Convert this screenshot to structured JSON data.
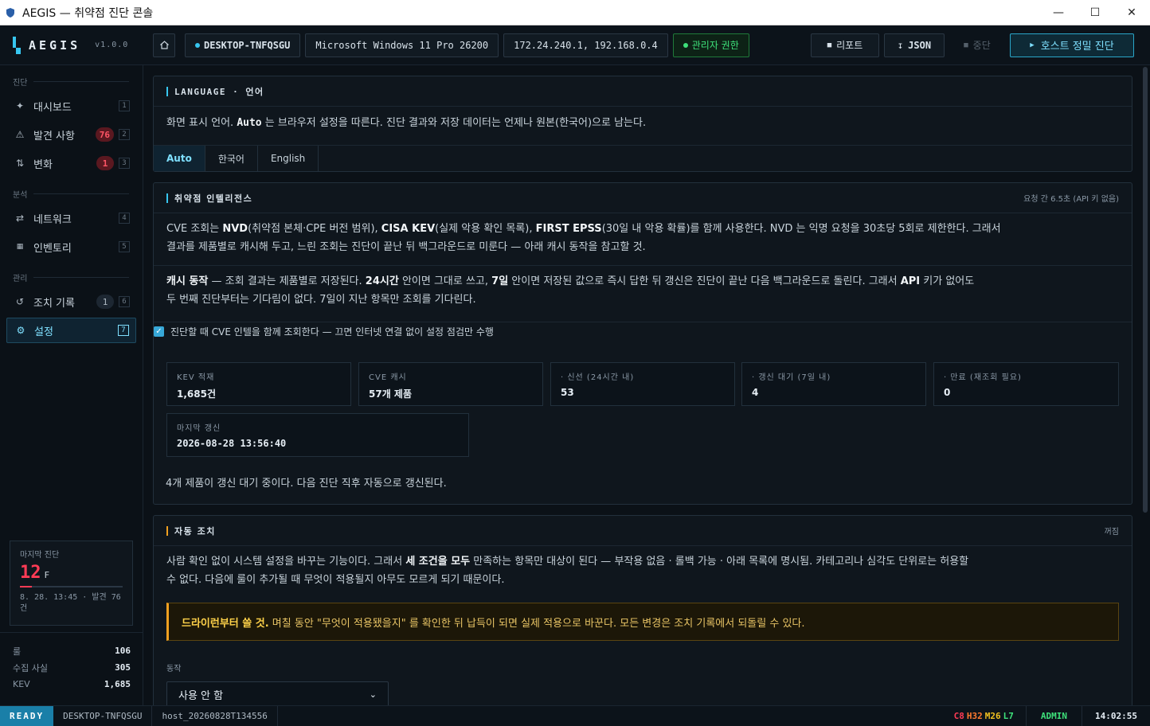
{
  "window": {
    "title": "AEGIS — 취약점 진단 콘솔"
  },
  "header": {
    "logo": "AEGIS",
    "version": "v1.0.0",
    "host": "DESKTOP-TNFQSGU",
    "os": "Microsoft Windows 11 Pro 26200",
    "ips": "172.24.240.1, 192.168.0.4",
    "admin": "관리자 권한",
    "report": "리포트",
    "json": "JSON",
    "stop": "중단",
    "scan": "호스트 정밀 진단"
  },
  "sidebar": {
    "sections": [
      "진단",
      "분석",
      "관리"
    ],
    "items": [
      {
        "label": "대시보드",
        "key": "1",
        "badge": ""
      },
      {
        "label": "발견 사항",
        "key": "2",
        "badge": "76"
      },
      {
        "label": "변화",
        "key": "3",
        "badge": "1"
      },
      {
        "label": "네트워크",
        "key": "4",
        "badge": ""
      },
      {
        "label": "인벤토리",
        "key": "5",
        "badge": ""
      },
      {
        "label": "조치 기록",
        "key": "6",
        "badge": "1"
      },
      {
        "label": "설정",
        "key": "7",
        "badge": ""
      }
    ],
    "last_scan": {
      "label": "마지막 진단",
      "score": "12",
      "grade": "F",
      "score_fraction": 0.12,
      "meta": "8. 28. 13:45 · 발견 76건"
    },
    "stats": [
      {
        "k": "룰",
        "v": "106"
      },
      {
        "k": "수집 사실",
        "v": "305"
      },
      {
        "k": "KEV",
        "v": "1,685"
      }
    ]
  },
  "language_panel": {
    "title": "LANGUAGE · 언어",
    "desc_pre": "화면 표시 언어.",
    "desc_bold": "Auto",
    "desc_post": "는 브라우저 설정을 따른다. 진단 결과와 저장 데이터는 언제나 원본(한국어)으로 남는다.",
    "tabs": [
      "Auto",
      "한국어",
      "English"
    ],
    "active_tab": "Auto"
  },
  "intel_panel": {
    "title": "취약점 인텔리전스",
    "right": "요청 간 6.5초 (API 키 없음)",
    "p1_a": "CVE 조회는 ",
    "p1_nvd": "NVD",
    "p1_b": "(취약점 본체·CPE 버전 범위), ",
    "p1_kev": "CISA KEV",
    "p1_c": "(실제 악용 확인 목록), ",
    "p1_epss": "FIRST EPSS",
    "p1_d": "(30일 내 악용 확률)를 함께 사용한다. NVD 는 익명 요청을 30초당 5회로 제한한다. 그래서",
    "p1_line2": "결과를 제품별로 캐시해 두고, 느린 조회는 진단이 끝난 뒤 백그라운드로 미룬다 — 아래 캐시 동작을 참고할 것.",
    "p2_head": "캐시 동작",
    "p2_a": " — 조회 결과는 제품별로 저장된다. ",
    "p2_24": "24시간",
    "p2_b": " 안이면 그대로 쓰고, ",
    "p2_7": "7일",
    "p2_c": " 안이면 저장된 값으로 즉시 답한 뒤 갱신은 진단이 끝난 다음 백그라운드로 돌린다. 그래서 ",
    "p2_api": "API",
    "p2_d": " 키가 없어도",
    "p2_line2": "두 번째 진단부터는 기다림이 없다. 7일이 지난 항목만 조회를 기다린다.",
    "checkbox": "진단할 때 CVE 인텔을 함께 조회한다 — 끄면 인터넷 연결 없이 설정 점검만 수행",
    "metrics": [
      {
        "label": "KEV 적재",
        "value": "1,685건"
      },
      {
        "label": "CVE 캐시",
        "value": "57개 제품"
      },
      {
        "label": "· 신선 (24시간 내)",
        "value": "53"
      },
      {
        "label": "· 갱신 대기 (7일 내)",
        "value": "4"
      },
      {
        "label": "· 만료 (재조회 필요)",
        "value": "0"
      },
      {
        "label": "마지막 갱신",
        "value": "2026-08-28 13:56:40"
      }
    ],
    "footer": "4개 제품이 갱신 대기 중이다. 다음 진단 직후 자동으로 갱신된다."
  },
  "auto_panel": {
    "title": "자동 조치",
    "right": "꺼짐",
    "p_a": "사람 확인 없이 시스템 설정을 바꾸는 기능이다. 그래서 ",
    "p_bold": "세 조건을 모두",
    "p_b": " 만족하는 항목만 대상이 된다 — 부작용 없음 · 롤백 가능 · 아래 목록에 명시됨. 카테고리나 심각도 단위로는 허용할",
    "p_line2": "수 없다. 다음에 룰이 추가될 때 무엇이 적용될지 아무도 모르게 되기 때문이다.",
    "warn_bold": "드라이런부터 쓸 것.",
    "warn_rest": " 며칠 동안 \"무엇이 적용됐을지\" 를 확인한 뒤 납득이 되면 실제 적용으로 바꾼다. 모든 변경은 조치 기록에서 되돌릴 수 있다.",
    "action_label": "동작",
    "action_value": "사용 안 함"
  },
  "statusbar": {
    "ready": "READY",
    "host": "DESKTOP-TNFQSGU",
    "session": "host_20260828T134556",
    "c": "C8",
    "h": "H32",
    "m": "M26",
    "l": "L7",
    "role": "ADMIN",
    "time": "14:02:55"
  },
  "colors": {
    "accent": "#37c6f0",
    "critical": "#ff3b55",
    "high": "#ff7a2f",
    "medium": "#f0c020",
    "low": "#3ee07a"
  }
}
